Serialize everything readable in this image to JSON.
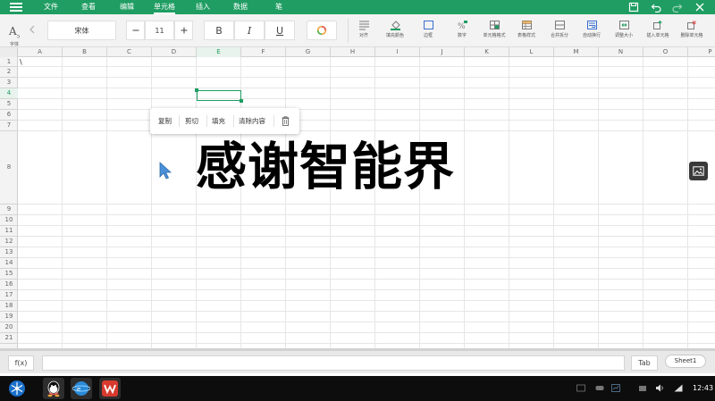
{
  "menubar": {
    "items": [
      "文件",
      "查看",
      "编辑",
      "单元格",
      "插入",
      "数据",
      "笔"
    ],
    "active_item": "单元格"
  },
  "ribbon": {
    "font_label": "字体",
    "font_name": "宋体",
    "font_size": "11",
    "bold_label": "B",
    "italic_label": "I",
    "underline_label": "U",
    "tools": [
      {
        "label": "对齐",
        "icon": "align-icon"
      },
      {
        "label": "填充颜色",
        "icon": "fill-color-icon"
      },
      {
        "label": "边框",
        "icon": "border-icon"
      },
      {
        "label": "数字",
        "icon": "number-format-icon"
      },
      {
        "label": "单元格格式",
        "icon": "cell-format-icon"
      },
      {
        "label": "表格样式",
        "icon": "table-style-icon"
      },
      {
        "label": "合并拆分",
        "icon": "merge-split-icon"
      },
      {
        "label": "自动换行",
        "icon": "wrap-text-icon"
      },
      {
        "label": "调整大小",
        "icon": "resize-icon"
      },
      {
        "label": "插入单元格",
        "icon": "insert-cell-icon"
      },
      {
        "label": "删除单元格",
        "icon": "delete-cell-icon"
      }
    ]
  },
  "sheet": {
    "columns": [
      "A",
      "B",
      "C",
      "D",
      "E",
      "F",
      "G",
      "H",
      "I",
      "J",
      "K",
      "L",
      "M",
      "N",
      "O",
      "P"
    ],
    "active_column": "E",
    "rows": [
      "1",
      "2",
      "3",
      "4",
      "5",
      "6",
      "7",
      "8",
      "9",
      "10",
      "11",
      "12",
      "13",
      "14",
      "15",
      "16",
      "17",
      "18",
      "19",
      "20",
      "21"
    ],
    "active_row": "4",
    "a1_value": "\\",
    "big_text": "感谢智能界"
  },
  "context_menu": {
    "items": [
      "复制",
      "剪切",
      "填充",
      "清除内容"
    ],
    "delete_icon": "trash-icon"
  },
  "formula_bar": {
    "fx_label": "f(x)",
    "formula_value": "",
    "tab_label": "Tab",
    "sheet_tab": "Sheet1"
  },
  "taskbar": {
    "apps": [
      "start-menu-icon",
      "qq-icon",
      "browser-icon",
      "wps-icon"
    ],
    "clock": "12:43"
  },
  "colors": {
    "accent": "#1f9d62",
    "menubar_bg": "#1f9d62",
    "taskbar_bg": "#0d0d0d"
  }
}
